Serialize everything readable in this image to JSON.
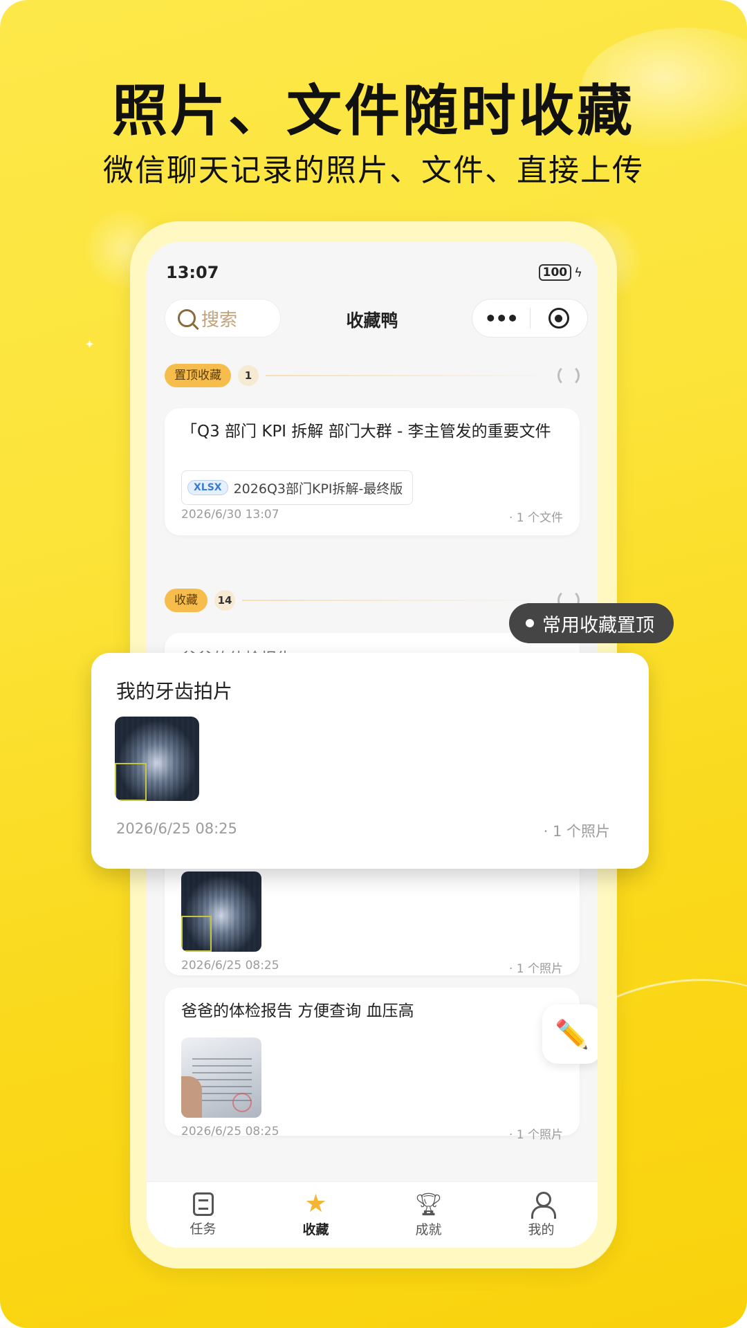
{
  "promo": {
    "headline": "照片、文件随时收藏",
    "subline": "微信聊天记录的照片、文件、直接上传"
  },
  "status_bar": {
    "time": "13:07",
    "battery": "100"
  },
  "nav": {
    "search_placeholder": "搜索",
    "title": "收藏鸭",
    "more_label": "•••"
  },
  "pinned_section": {
    "tag": "置顶收藏",
    "count": "1",
    "card": {
      "title": "「Q3 部门 KPI 拆解 部门大群 - 李主管发的重要文件",
      "file_ext": "XLSX",
      "file_name": "2026Q3部门KPI拆解-最终版",
      "date": "2026/6/30 13:07",
      "summary": "· 1 个文件"
    }
  },
  "fav_section": {
    "tag": "收藏",
    "count": "14",
    "hidden_title_partial": "爸爸的体检报告"
  },
  "cards": [
    {
      "date": "2026/6/25 08:25",
      "summary": "· 1 个照片"
    },
    {
      "title": "爸爸的体检报告 方便查询 血压高",
      "date": "2026/6/25 08:25",
      "summary": "· 1 个照片"
    }
  ],
  "popup_card": {
    "title": "我的牙齿拍片",
    "date": "2026/6/25 08:25",
    "summary": "· 1 个照片"
  },
  "tooltip": "常用收藏置顶",
  "tabbar": [
    {
      "label": "任务",
      "icon": "task-list-icon"
    },
    {
      "label": "收藏",
      "icon": "star-icon",
      "active": true
    },
    {
      "label": "成就",
      "icon": "trophy-icon"
    },
    {
      "label": "我的",
      "icon": "user-icon"
    }
  ],
  "colors": {
    "brand_yellow": "#fce43a",
    "tag_orange": "#f6bd4d",
    "accent_star": "#f2b632"
  }
}
